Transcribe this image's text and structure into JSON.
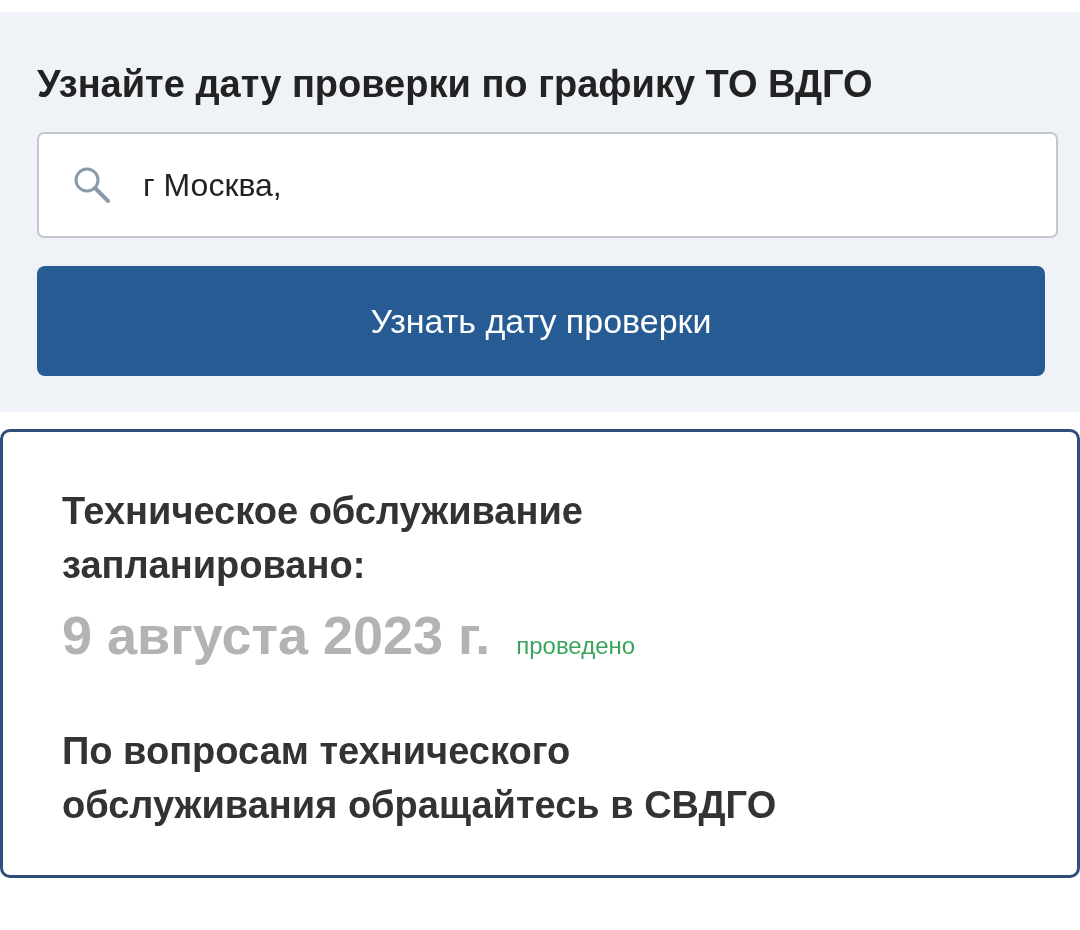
{
  "search_panel": {
    "title": "Узнайте дату проверки по графику ТО ВДГО",
    "address_field": {
      "value": "г Москва,"
    },
    "submit_button": "Узнать дату проверки"
  },
  "result_card": {
    "heading": "Техническое обслуживание запланировано:",
    "date": "9 августа 2023 г.",
    "status": "проведено",
    "contact_note": "По вопросам технического обслуживания обращайтесь в СВДГО"
  }
}
